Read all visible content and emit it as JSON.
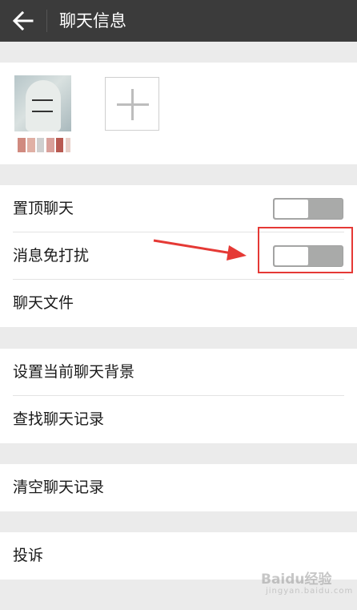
{
  "header": {
    "title": "聊天信息",
    "back_icon": "arrow-left-icon"
  },
  "members": {
    "add_icon": "plus-icon"
  },
  "settings": {
    "pin_chat": {
      "label": "置顶聊天",
      "enabled": false
    },
    "mute_notifications": {
      "label": "消息免打扰",
      "enabled": false
    },
    "chat_files": {
      "label": "聊天文件"
    },
    "set_background": {
      "label": "设置当前聊天背景"
    },
    "search_history": {
      "label": "查找聊天记录"
    },
    "clear_history": {
      "label": "清空聊天记录"
    },
    "report": {
      "label": "投诉"
    }
  },
  "annotation": {
    "highlight_color": "#e53935"
  },
  "watermark": {
    "text": "Baidu经验",
    "sub": "jingyan.baidu.com"
  },
  "colors": {
    "topbar": "#3b3b3b",
    "background": "#ebebeb",
    "toggle_off": "#a9aaa9"
  }
}
